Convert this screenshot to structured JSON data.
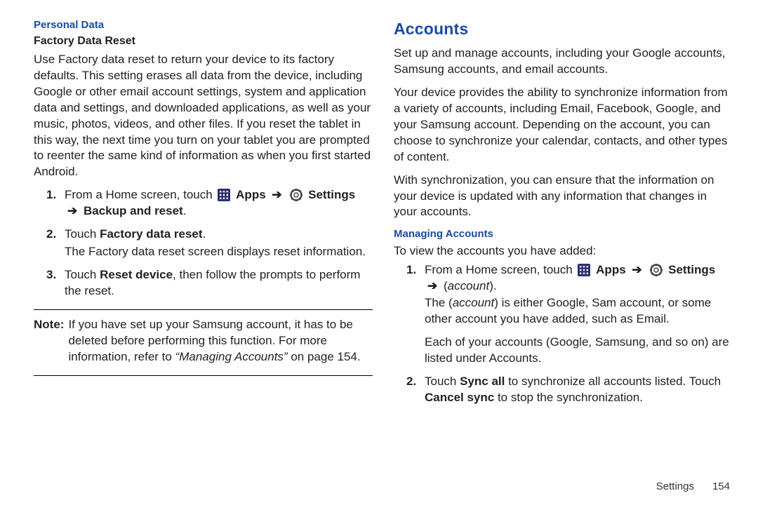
{
  "left": {
    "section_title": "Personal Data",
    "sub_title": "Factory Data Reset",
    "intro": "Use Factory data reset to return your device to its factory defaults. This setting erases all data from the device, including Google or other email account settings, system and application data and settings, and downloaded applications, as well as your music, photos, videos, and other files. If you reset the tablet in this way, the next time you turn on your tablet you are prompted to reenter the same kind of information as when you first started Android.",
    "step1": {
      "num": "1.",
      "lead": "From a Home screen, touch ",
      "apps": "Apps",
      "settings": "Settings",
      "arrow": "➔",
      "backup": "Backup and reset",
      "period": "."
    },
    "step2": {
      "num": "2.",
      "lead": "Touch ",
      "bold": "Factory data reset",
      "period": ".",
      "sub": "The Factory data reset screen displays reset information."
    },
    "step3": {
      "num": "3.",
      "lead": "Touch ",
      "bold": "Reset device",
      "tail": ", then follow the prompts to perform the reset."
    },
    "note_label": "Note:",
    "note_body_pre": "If you have set up your Samsung account, it has to be deleted before performing this function. For more information, refer to ",
    "note_ref": "“Managing Accounts”",
    "note_body_post": " on page 154."
  },
  "right": {
    "title": "Accounts",
    "p1": "Set up and manage accounts, including your Google accounts, Samsung accounts, and email accounts.",
    "p2": "Your device provides the ability to synchronize information from a variety of accounts, including Email, Facebook, Google, and your Samsung account. Depending on the account, you can choose to synchronize your calendar, contacts, and other types of content.",
    "p3": "With synchronization, you can ensure that the information on your device is updated with any information that changes in your accounts.",
    "subsection": "Managing Accounts",
    "p4": "To view the accounts you have added:",
    "step1": {
      "num": "1.",
      "lead": "From a Home screen, touch ",
      "apps": "Apps",
      "settings": "Settings",
      "arrow": "➔",
      "account": "account",
      "open_paren": "(",
      "close_paren": ").",
      "sub_pre": "The (",
      "sub_acc": "account",
      "sub_post": ") is either Google, Sam account, or some other account you have added, such as Email.",
      "sub2": "Each of your accounts (Google, Samsung, and so on) are listed under Accounts."
    },
    "step2": {
      "num": "2.",
      "lead": "Touch ",
      "sync": "Sync all",
      "mid": " to synchronize all accounts listed. Touch ",
      "cancel": "Cancel sync",
      "tail": " to stop the synchronization."
    }
  },
  "footer": {
    "section": "Settings",
    "page": "154"
  },
  "icons": {
    "apps": "apps-grid-icon",
    "settings": "gear-icon"
  }
}
